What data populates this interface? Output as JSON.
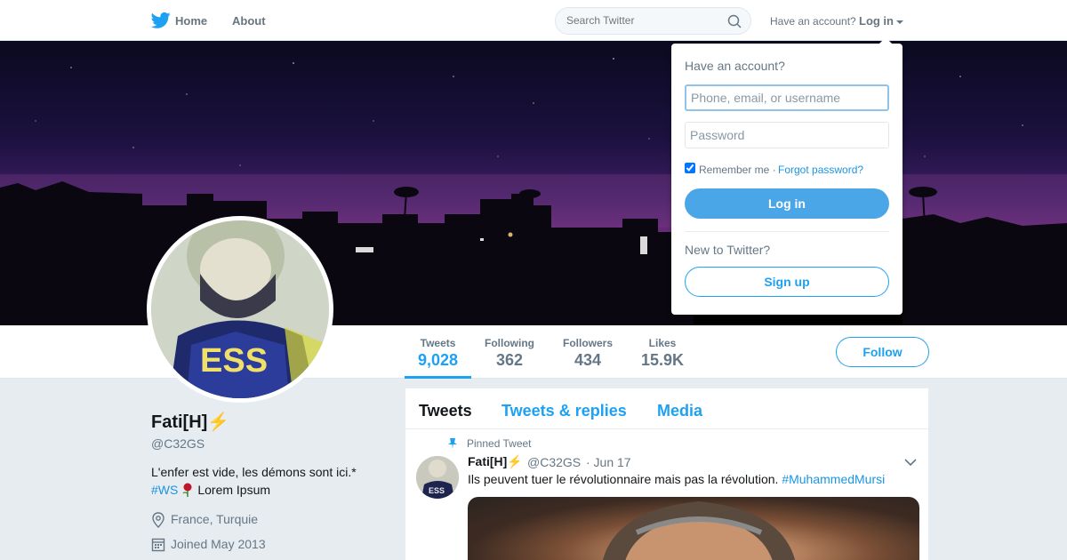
{
  "nav": {
    "home": "Home",
    "about": "About",
    "search_placeholder": "Search Twitter",
    "have_account": "Have an account?",
    "login": "Log in"
  },
  "profile": {
    "name": "Fati[H]",
    "name_emoji": "⚡",
    "handle": "@C32GS",
    "bio_line1": "L'enfer est vide, les démons sont ici.*",
    "bio_hashtag": "#WS",
    "bio_rest": "Lorem Ipsum",
    "location": "France, Turquie",
    "joined": "Joined May 2013"
  },
  "stats": [
    {
      "label": "Tweets",
      "value": "9,028"
    },
    {
      "label": "Following",
      "value": "362"
    },
    {
      "label": "Followers",
      "value": "434"
    },
    {
      "label": "Likes",
      "value": "15.9K"
    }
  ],
  "follow_label": "Follow",
  "timeline": {
    "tabs": [
      "Tweets",
      "Tweets & replies",
      "Media"
    ],
    "pinned_label": "Pinned Tweet",
    "tweet": {
      "name": "Fati[H]",
      "name_emoji": "⚡",
      "handle": "@C32GS",
      "date": "· Jun 17",
      "text": "Ils peuvent tuer le révolutionnaire mais pas la révolution.",
      "hashtag": "#MuhammedMursi"
    }
  },
  "login_dropdown": {
    "title": "Have an account?",
    "username_placeholder": "Phone, email, or username",
    "password_placeholder": "Password",
    "remember_label": "Remember me ·",
    "forgot_label": "Forgot password?",
    "login_button": "Log in",
    "new_label": "New to Twitter?",
    "signup_button": "Sign up"
  },
  "colors": {
    "brand_blue": "#1da1f2",
    "link_blue": "#1b95e0",
    "muted_text": "#657786",
    "page_background": "#e6ecf0"
  }
}
